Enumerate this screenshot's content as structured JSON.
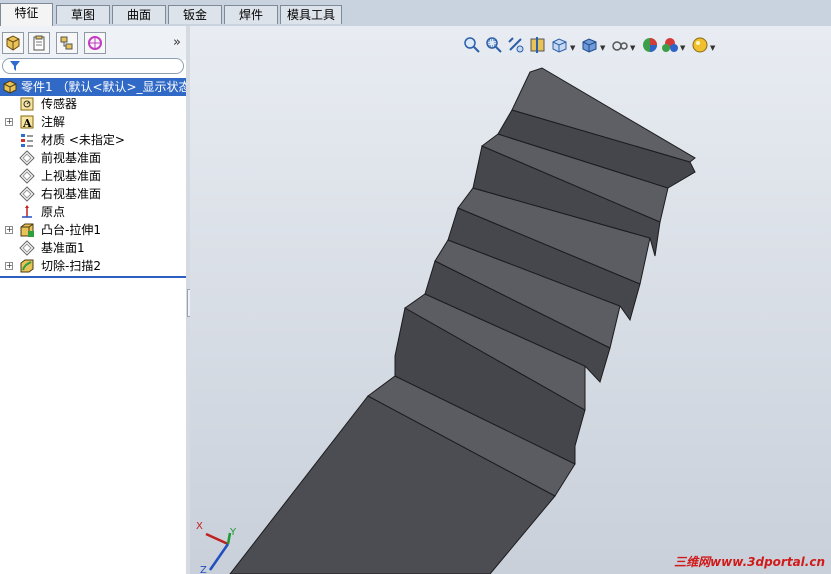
{
  "tabs": [
    {
      "label": "特征",
      "active": true
    },
    {
      "label": "草图"
    },
    {
      "label": "曲面"
    },
    {
      "label": "钣金"
    },
    {
      "label": "焊件"
    },
    {
      "label": "模具工具"
    }
  ],
  "panel": {
    "tab_icons": [
      "feature-manager-icon",
      "property-manager-icon",
      "configuration-manager-icon",
      "dim-xpert-icon"
    ],
    "collapse": "»",
    "filter_icon": "filter-icon"
  },
  "tree": {
    "root": {
      "label": "零件1 （默认<默认>_显示状态",
      "icon": "part-icon"
    },
    "items": [
      {
        "label": "传感器",
        "icon": "sensor-icon",
        "expandable": false
      },
      {
        "label": "注解",
        "icon": "annotation-icon",
        "expandable": true
      },
      {
        "label": "材质 <未指定>",
        "icon": "material-icon",
        "expandable": false
      },
      {
        "label": "前视基准面",
        "icon": "plane-icon",
        "expandable": false
      },
      {
        "label": "上视基准面",
        "icon": "plane-icon",
        "expandable": false
      },
      {
        "label": "右视基准面",
        "icon": "plane-icon",
        "expandable": false
      },
      {
        "label": "原点",
        "icon": "origin-icon",
        "expandable": false
      },
      {
        "label": "凸台-拉伸1",
        "icon": "extrude-icon",
        "expandable": true
      },
      {
        "label": "基准面1",
        "icon": "plane-icon",
        "expandable": false
      },
      {
        "label": "切除-扫描2",
        "icon": "sweep-cut-icon",
        "expandable": true
      }
    ]
  },
  "heads_up_toolbar": [
    "zoom-to-fit-icon",
    "zoom-to-area-icon",
    "previous-view-icon",
    "section-view-icon",
    "view-orientation-icon",
    "display-style-icon",
    "hide-show-icon",
    "edit-appearance-icon",
    "apply-scene-icon",
    "view-settings-icon"
  ],
  "triad": {
    "x_label": "X",
    "y_label": "Y",
    "z_label": "Z"
  },
  "watermark": "三维网www.3dportal.cn",
  "colors": {
    "selection": "#3169c6",
    "tab_bar": "#c9d3df",
    "model": "#4a4c52",
    "watermark": "#d11a1a"
  }
}
